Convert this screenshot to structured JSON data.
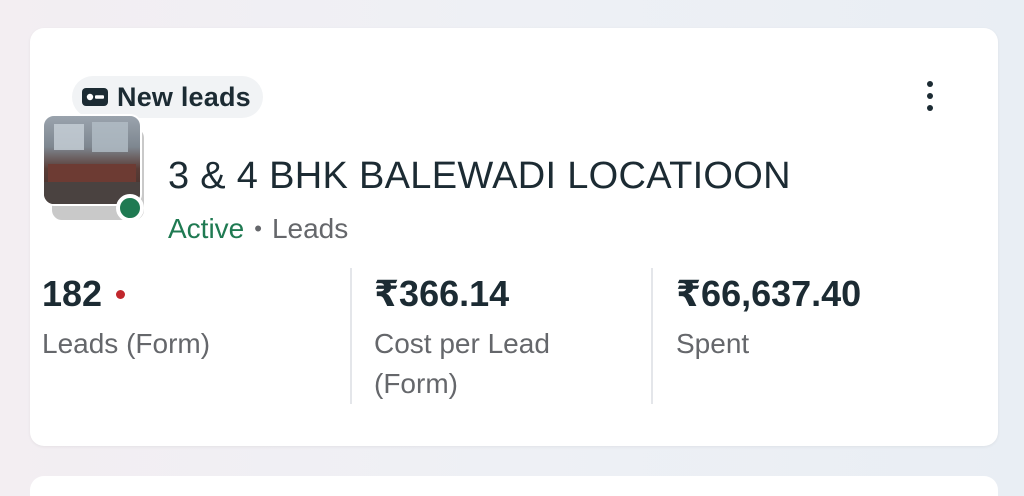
{
  "card": {
    "badge": {
      "icon": "lead-form-icon",
      "label": "New leads"
    },
    "more_menu_icon": "more-vertical-icon",
    "campaign": {
      "thumbnail_icon": "ad-thumbnail-image",
      "title": "3 & 4 BHK BALEWADI LOCATIOON",
      "status": "Active",
      "separator": "•",
      "objective": "Leads"
    },
    "metrics": [
      {
        "value": "182",
        "label": "Leads (Form)",
        "indicator_color": "#c1272d"
      },
      {
        "value": "₹366.14",
        "label": "Cost per Lead (Form)"
      },
      {
        "value": "₹66,637.40",
        "label": "Spent"
      }
    ]
  },
  "colors": {
    "active_status": "#1f7a52",
    "text_primary": "#1c2b33",
    "text_secondary": "#65676b",
    "alert_dot": "#c1272d"
  }
}
